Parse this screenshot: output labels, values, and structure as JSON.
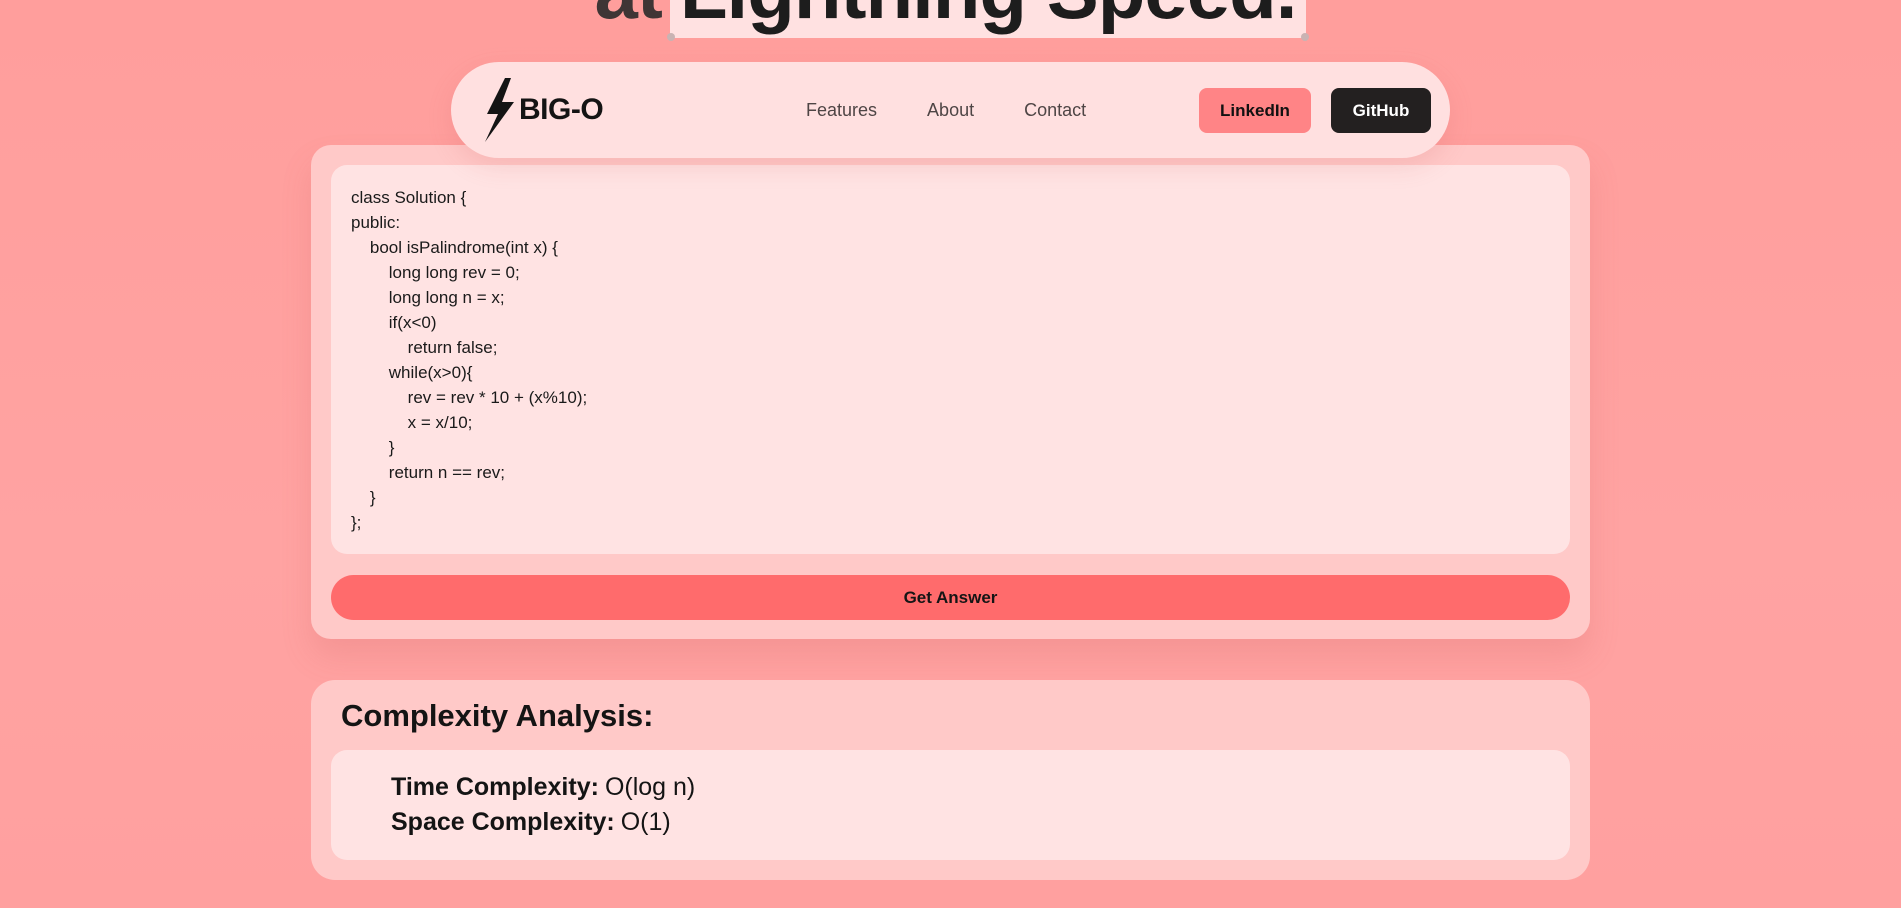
{
  "hero": {
    "prefix": "at",
    "highlight": "Lightning Speed."
  },
  "navbar": {
    "logo_icon": "lightning-bolt-icon",
    "logo_text": "BIG-O",
    "links": [
      {
        "label": "Features"
      },
      {
        "label": "About"
      },
      {
        "label": "Contact"
      }
    ],
    "linkedin_label": "LinkedIn",
    "github_label": "GitHub"
  },
  "editor": {
    "code": "class Solution {\npublic:\n    bool isPalindrome(int x) {\n        long long rev = 0;\n        long long n = x;\n        if(x<0)\n            return false;\n        while(x>0){\n            rev = rev * 10 + (x%10);\n            x = x/10;\n        }\n        return n == rev;\n    }\n};",
    "submit_label": "Get Answer"
  },
  "analysis": {
    "title": "Complexity Analysis:",
    "time_label": "Time Complexity:",
    "time_value": "O(log n)",
    "space_label": "Space Complexity:",
    "space_value": "O(1)"
  },
  "colors": {
    "background": "#ffa09f",
    "panel": "#ffc9c8",
    "panel_inner": "#ffe3e3",
    "accent": "#ff6b6c",
    "linkedin_button": "#ff8486",
    "github_button": "#232020"
  }
}
